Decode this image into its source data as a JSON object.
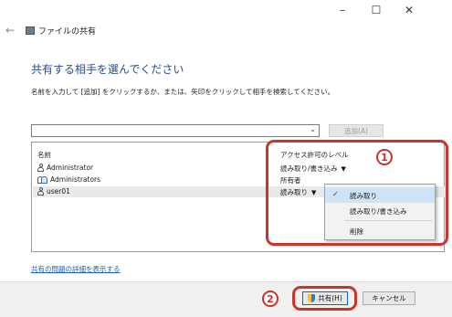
{
  "titlebar": {
    "minimize": "–",
    "maximize": "☐",
    "close": "✕"
  },
  "nav": {
    "back": "←"
  },
  "app": {
    "title": "ファイルの共有"
  },
  "heading": "共有する相手を選んでください",
  "instruction": "名前を入力して [追加] をクリックするか、または、矢印をクリックして相手を検索してください。",
  "combo": {
    "value": "",
    "arrow": "⌄"
  },
  "add_button": "追加(A)",
  "list": {
    "col_name": "名前",
    "col_perm": "アクセス許可のレベル",
    "rows": [
      {
        "name": "Administrator",
        "perm": "読み取り/書き込み",
        "arrow": "▼"
      },
      {
        "name": "Administrators",
        "perm": "所有者",
        "arrow": ""
      },
      {
        "name": "user01",
        "perm": "読み取り",
        "arrow": "▼"
      }
    ]
  },
  "menu": {
    "items": [
      {
        "label": "読み取り",
        "check": "✓"
      },
      {
        "label": "読み取り/書き込み",
        "check": ""
      },
      {
        "label": "削除",
        "check": ""
      }
    ]
  },
  "link": "共有の問題の詳細を表示する",
  "buttons": {
    "share": "共有(H)",
    "cancel": "キャンセル"
  },
  "annotations": {
    "badge1": "1",
    "badge2": "2",
    "color": "#c9342f"
  }
}
